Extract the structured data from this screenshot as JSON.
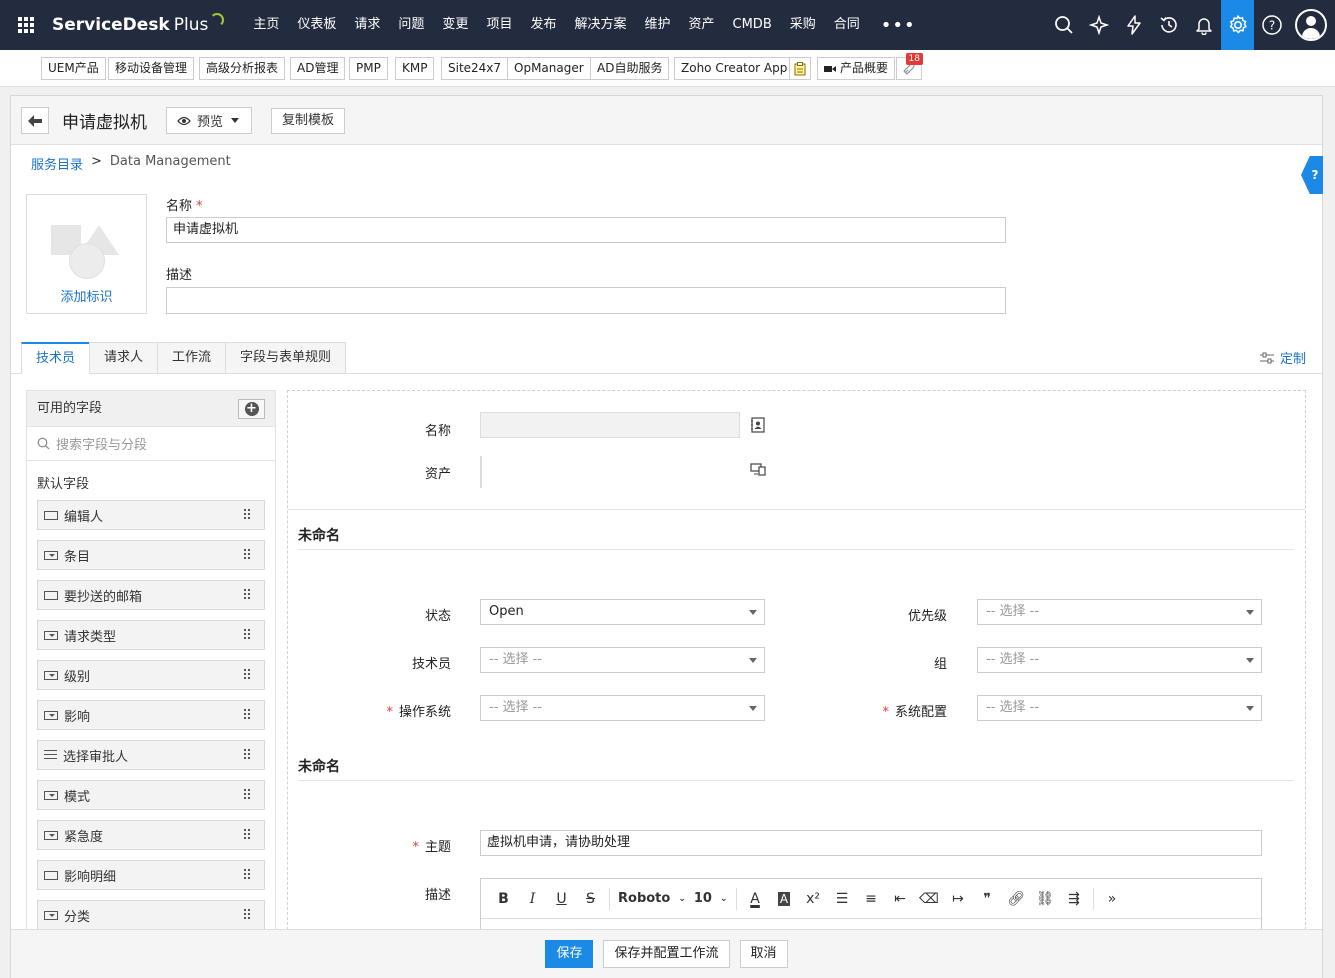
{
  "app": {
    "name": "ServiceDesk",
    "name_suffix": "Plus"
  },
  "nav": {
    "items": [
      "主页",
      "仪表板",
      "请求",
      "问题",
      "变更",
      "项目",
      "发布",
      "解决方案",
      "维护",
      "资产",
      "CMDB",
      "采购",
      "合同"
    ],
    "more": "•••"
  },
  "products": [
    "UEM产品",
    "移动设备管理",
    "高级分析报表",
    "AD管理",
    "PMP",
    "KMP",
    "Site24x7",
    "OpManager",
    "AD自助服务",
    "Zoho Creator App"
  ],
  "product_overview": {
    "label": "产品概要",
    "badge": "18"
  },
  "header": {
    "title": "申请虚拟机",
    "preview_label": "预览",
    "copy_label": "复制模板"
  },
  "breadcrumb": {
    "root": "服务目录",
    "sep": ">",
    "current": "Data Management"
  },
  "help": "?",
  "template": {
    "add_logo": "添加标识",
    "name_label": "名称",
    "name_value": "申请虚拟机",
    "desc_label": "描述",
    "desc_value": ""
  },
  "tabs": [
    "技术员",
    "请求人",
    "工作流",
    "字段与表单规则"
  ],
  "customize_label": "定制",
  "fields_panel": {
    "title": "可用的字段",
    "search_placeholder": "搜索字段与分段",
    "section": "默认字段",
    "items": [
      "编辑人",
      "条目",
      "要抄送的邮箱",
      "请求类型",
      "级别",
      "影响",
      "选择审批人",
      "模式",
      "紧急度",
      "影响明细",
      "分类"
    ]
  },
  "form": {
    "requester_label": "名称",
    "asset_label": "资产",
    "section1_title": "未命名",
    "status_label": "状态",
    "status_value": "Open",
    "priority_label": "优先级",
    "tech_label": "技术员",
    "group_label": "组",
    "os_label": "操作系统",
    "syscfg_label": "系统配置",
    "select_placeholder": "-- 选择 --",
    "section2_title": "未命名",
    "subject_label": "主题",
    "subject_value": "虚拟机申请，请协助处理",
    "desc_label": "描述",
    "font_name": "Roboto",
    "font_size": "10"
  },
  "footer": {
    "save": "保存",
    "save_config": "保存并配置工作流",
    "cancel": "取消"
  },
  "colors": {
    "nav_bg": "#232b3e",
    "accent": "#1b8ae6",
    "required": "#e53935",
    "link": "#1a73c9"
  }
}
